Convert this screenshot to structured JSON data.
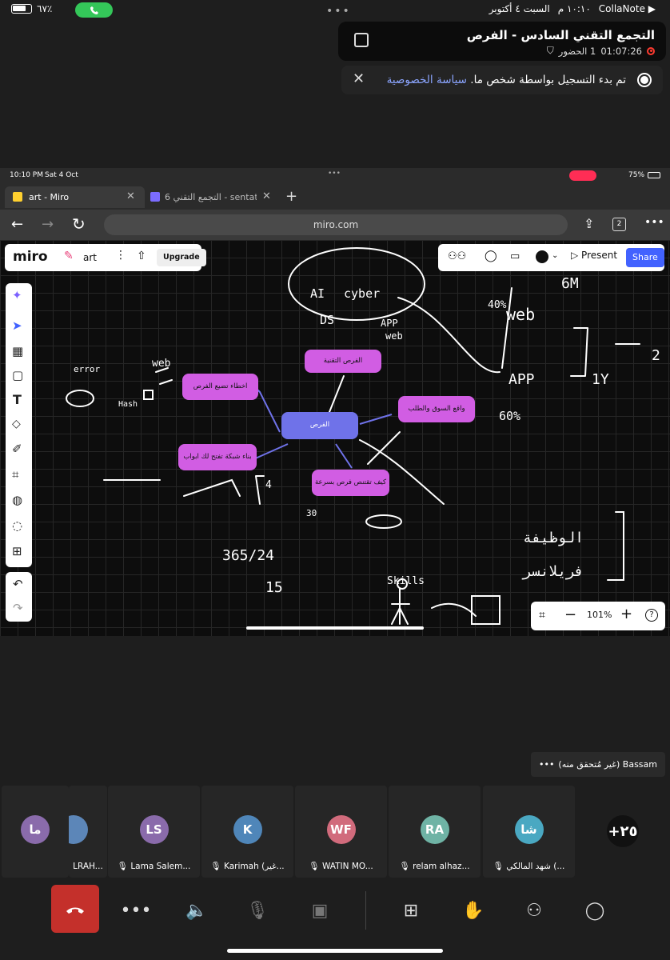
{
  "status_bar": {
    "battery": "٦٧٪",
    "app": "CollaNote",
    "time": "١٠:١٠ م",
    "date": "السبت ٤ أكتوبر"
  },
  "notification": {
    "title": "التجمع التقني السادس - الفرص",
    "duration": "01:07:26",
    "attendance": "1 الحضور"
  },
  "recording_banner": {
    "text": "تم بدء التسجيل بواسطة شخص ما.",
    "link": "سياسة الخصوصية"
  },
  "shared_screen": {
    "status_time": "10:10 PM",
    "status_date": "Sat 4 Oct",
    "status_battery": "75%",
    "tabs": [
      {
        "label": "art - Miro"
      },
      {
        "label": "التجمع التقني 6 - sentati..."
      }
    ],
    "tab_count": "2",
    "url": "miro.com",
    "miro": {
      "logo": "miro",
      "board_name": "art",
      "upgrade": "Upgrade",
      "present": "Present",
      "share": "Share",
      "zoom": "101%"
    },
    "nodes": {
      "center": "الفرص",
      "tech": "الفرص التقنية",
      "mistakes": "اخطاء تضيع الفرص",
      "market": "واقع السوق والطلب",
      "network": "بناء شبكة تفتح لك ابواب",
      "hunt": "كيف تقتنص فرص بسرعة"
    },
    "handwriting": {
      "ai": "AI",
      "cyber": "cyber",
      "ds": "DS",
      "app": "APP",
      "web": "web",
      "six_m": "6M",
      "forty": "40%",
      "web2": "web",
      "app2": "APP",
      "sixty": "60%",
      "one_y": "1Y",
      "two": "2",
      "error": "error",
      "web3": "web",
      "hash": "Hash",
      "fraction": "365/24",
      "fifteen": "15",
      "thirty": "30",
      "skills": "Skills",
      "job": "الوظيفة",
      "freelance": "فريلانسر",
      "four": "4"
    }
  },
  "speaker_label": "Bassam (غير مُتحقق منه)",
  "participants": [
    {
      "initials": "ما",
      "name": "",
      "color": "#8a6bab"
    },
    {
      "initials": "",
      "name": "LRAH...",
      "color": "#5c86b8"
    },
    {
      "initials": "LS",
      "name": "Lama Salem...",
      "color": "#8a6bab"
    },
    {
      "initials": "K",
      "name": "Karimah (غير...",
      "color": "#4f86b9"
    },
    {
      "initials": "WF",
      "name": "WATIN MO...",
      "color": "#d16b7c"
    },
    {
      "initials": "RA",
      "name": "relam alhaz...",
      "color": "#6fb3a5"
    },
    {
      "initials": "شا",
      "name": "شهد المالكي (...",
      "color": "#4aa8c2"
    }
  ],
  "more_participants": "+٢٥"
}
